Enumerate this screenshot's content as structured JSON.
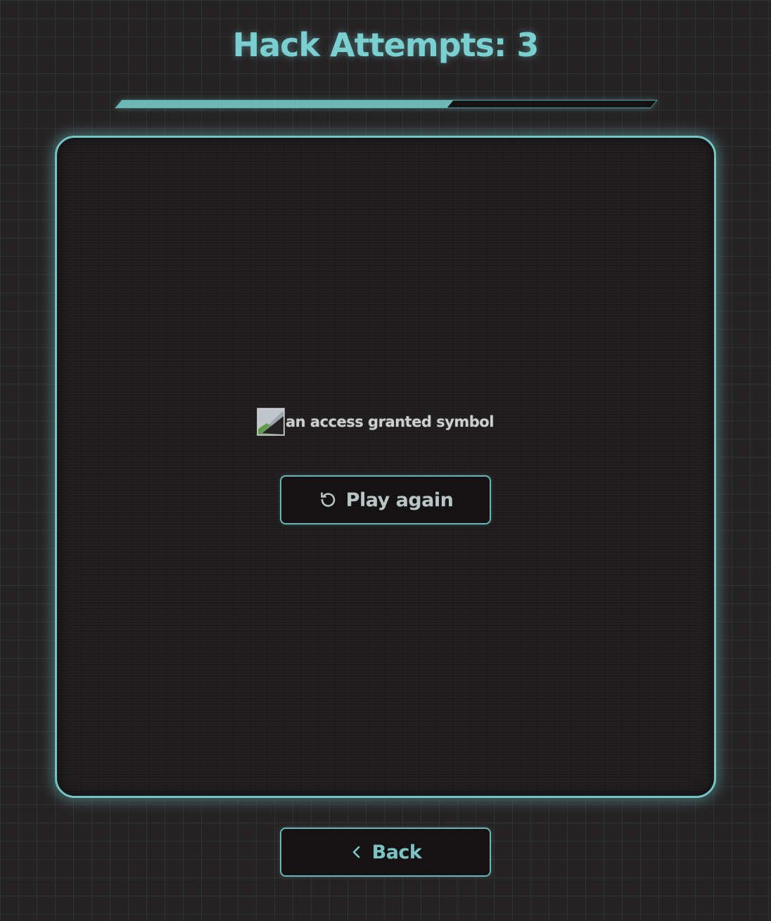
{
  "header": {
    "title": "Hack Attempts: 3"
  },
  "progress": {
    "fraction": 0.62
  },
  "panel": {
    "image_alt": "an access granted symbol"
  },
  "buttons": {
    "play_again_label": "Play again",
    "play_again_icon": "refresh-icon",
    "back_label": "Back",
    "back_icon": "chevron-left-icon"
  },
  "colors": {
    "accent": "#74c4c4",
    "background": "#262324",
    "panel_background": "#211e1f"
  }
}
